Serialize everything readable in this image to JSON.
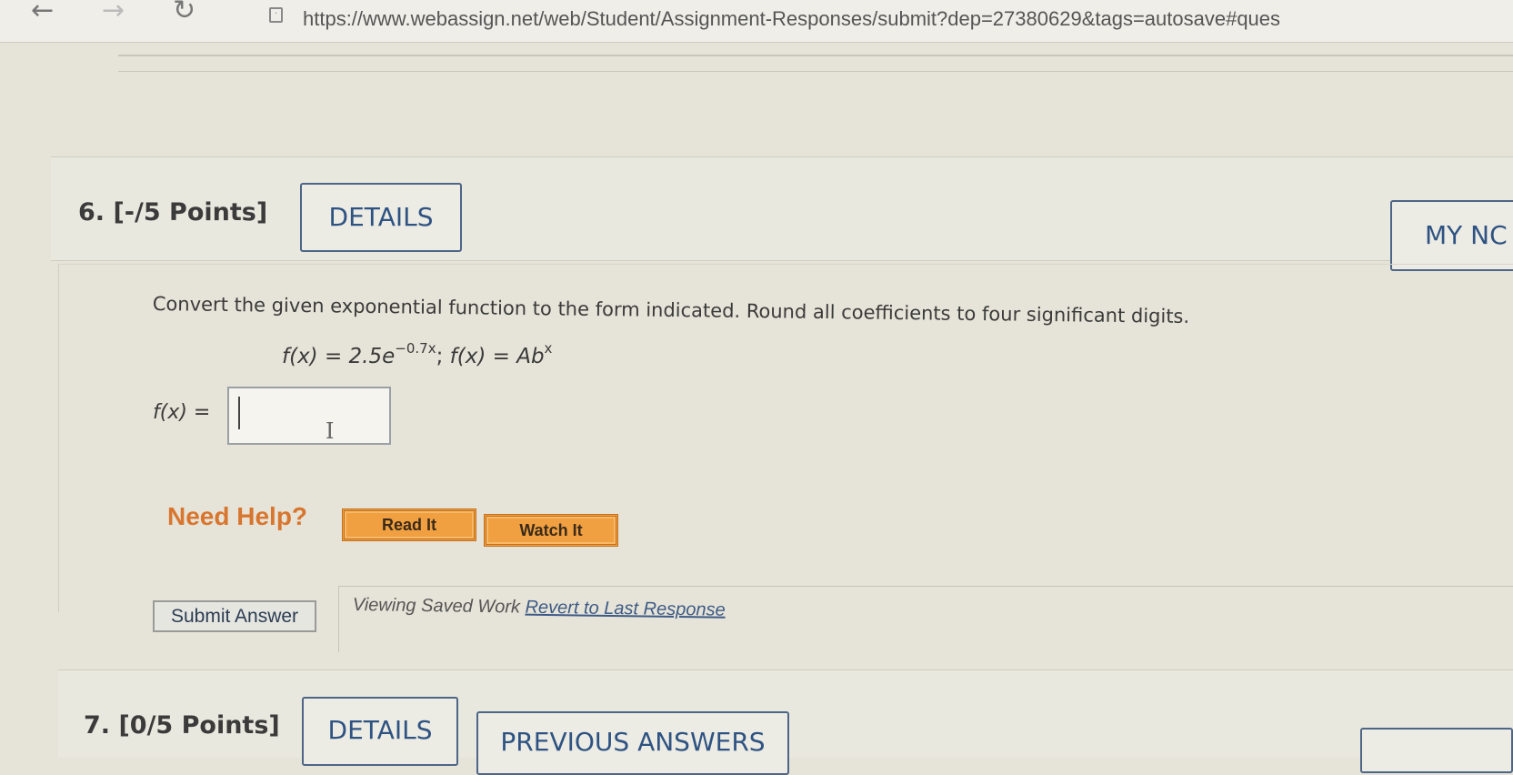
{
  "browser": {
    "back_icon": "arrow-left-icon",
    "forward_icon": "arrow-right-icon",
    "reload_icon": "reload-icon",
    "url": "https://www.webassign.net/web/Student/Assignment-Responses/submit?dep=27380629&tags=autosave#ques"
  },
  "question6": {
    "title": "6.  [-/5 Points]",
    "details_label": "DETAILS",
    "my_notes_label": "MY NC",
    "prompt": "Convert the given exponential function to the form indicated. Round all coefficients to four significant digits.",
    "equation": {
      "lhs1": "f(x) = 2.5e",
      "exp1": "−0.7x",
      "sep": "; ",
      "lhs2": "f(x) = Ab",
      "exp2": "x"
    },
    "answer_label": "f(x) =",
    "answer_value": "",
    "need_help": "Need Help?",
    "read_it": "Read It",
    "watch_it": "Watch It",
    "submit_label": "Submit Answer",
    "viewing_saved": "Viewing Saved Work",
    "revert_link": "Revert to Last Response"
  },
  "question7": {
    "title": "7.  [0/5 Points]",
    "details_label": "DETAILS",
    "previous_answers_label": "PREVIOUS ANSWERS"
  },
  "colors": {
    "link_blue": "#2e5382",
    "help_orange": "#d8762f",
    "button_orange": "#f0a040"
  }
}
